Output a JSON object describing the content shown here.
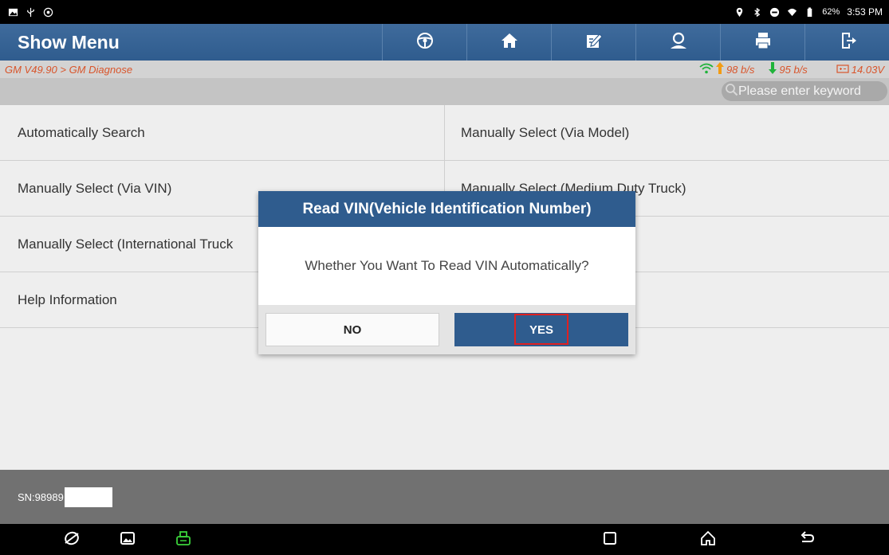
{
  "status_bar": {
    "battery": "62%",
    "time": "3:53 PM",
    "left_icons": [
      "notification-image-icon",
      "usb-icon",
      "settings-badge-icon"
    ],
    "right_icons": [
      "location-icon",
      "bluetooth-icon",
      "dnd-icon",
      "wifi-icon",
      "battery-icon"
    ]
  },
  "header": {
    "title": "Show Menu",
    "toolbar": [
      {
        "name": "steering-wheel-icon"
      },
      {
        "name": "home-icon"
      },
      {
        "name": "report-edit-icon"
      },
      {
        "name": "user-icon"
      },
      {
        "name": "print-icon"
      },
      {
        "name": "exit-icon"
      }
    ]
  },
  "breadcrumb": {
    "path": "GM V49.90 > GM Diagnose",
    "upload": "98 b/s",
    "download": "95 b/s",
    "voltage": "14.03V"
  },
  "search": {
    "placeholder": "Please enter keyword"
  },
  "menu": {
    "rows": [
      {
        "left": "Automatically Search",
        "right": "Manually Select (Via Model)"
      },
      {
        "left": "Manually Select (Via VIN)",
        "right": "Manually Select (Medium Duty Truck)"
      },
      {
        "left": "Manually Select (International Truck",
        "right": ""
      },
      {
        "left": "Help Information",
        "right": ""
      }
    ]
  },
  "footer": {
    "sn_label": "SN:98989"
  },
  "dialog": {
    "title": "Read VIN(Vehicle Identification Number)",
    "message": "Whether You Want To Read VIN Automatically?",
    "no_label": "NO",
    "yes_label": "YES"
  },
  "colors": {
    "header_blue": "#2f5c8e",
    "breadcrumb_orange": "#d9552b",
    "net_green": "#1fb33a",
    "highlight_red": "#e02020"
  }
}
